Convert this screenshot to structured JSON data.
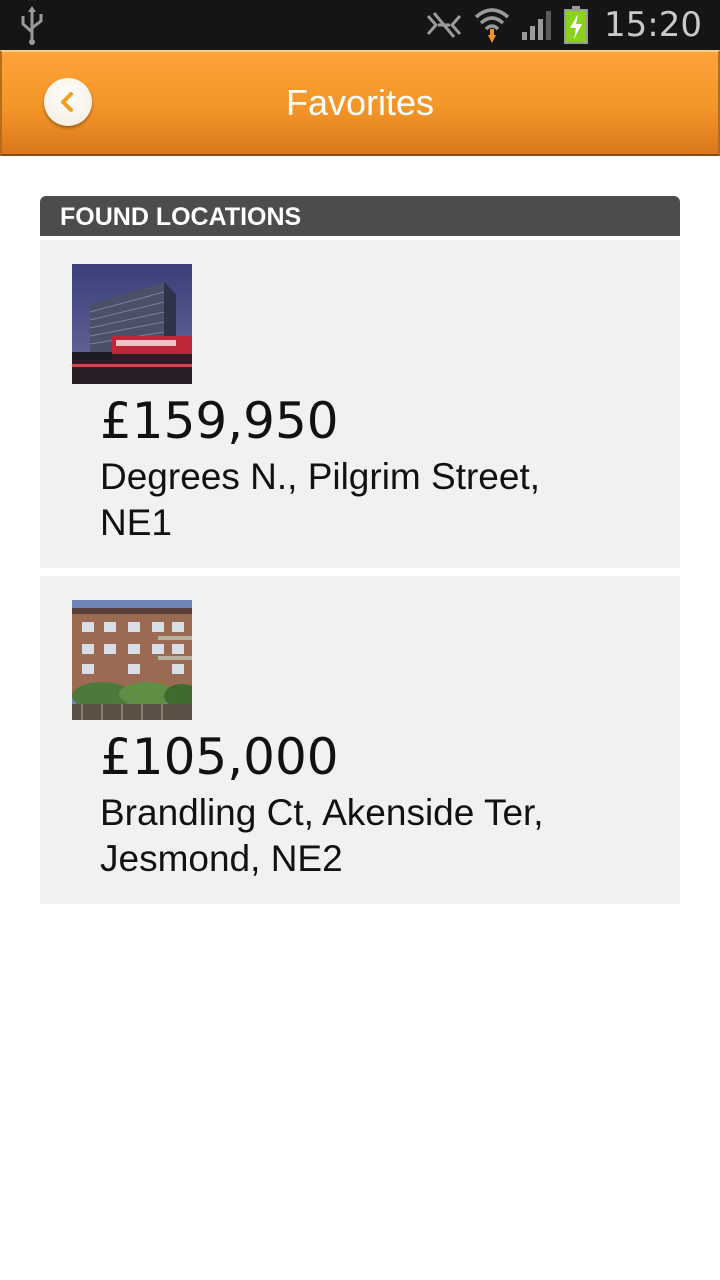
{
  "status_bar": {
    "time": "15:20",
    "icons": [
      "usb-icon",
      "nfc-icon",
      "wifi-icon",
      "signal-icon",
      "battery-charging-icon"
    ],
    "battery_color": "#8bd21b"
  },
  "action_bar": {
    "title": "Favorites",
    "back_icon": "chevron-left-icon",
    "accent": "#f39628"
  },
  "section": {
    "header": "FOUND LOCATIONS"
  },
  "listings": [
    {
      "price": "£159,950",
      "address": "Degrees N., Pilgrim Street, NE1",
      "image": "tall-glass-building-night-photo"
    },
    {
      "price": "£105,000",
      "address": "Brandling Ct, Akenside Ter, Jesmond, NE2",
      "image": "brick-apartment-block-photo"
    }
  ]
}
